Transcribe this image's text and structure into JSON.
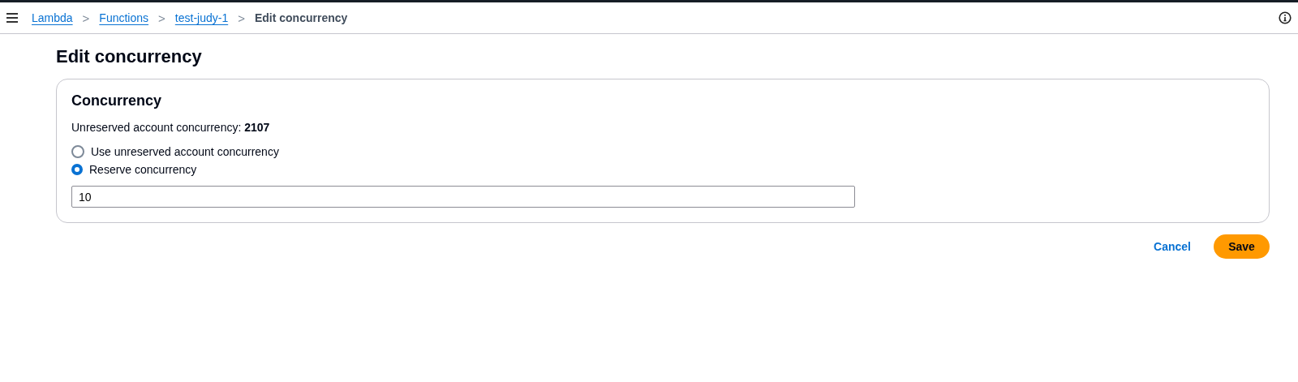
{
  "breadcrumbs": [
    {
      "label": "Lambda",
      "link": true
    },
    {
      "label": "Functions",
      "link": true
    },
    {
      "label": "test-judy-1",
      "link": true
    },
    {
      "label": "Edit concurrency",
      "link": false
    }
  ],
  "separator": ">",
  "page_title": "Edit concurrency",
  "panel": {
    "title": "Concurrency",
    "summary": "Unreserved account concurrency: **2107**",
    "options": [
      {
        "label": "Use unreserved account concurrency",
        "selected": false
      },
      {
        "label": "Reserve concurrency",
        "selected": true
      }
    ],
    "input": {
      "value": "10"
    }
  },
  "actions": {
    "cancel": "Cancel",
    "save": "Save"
  }
}
